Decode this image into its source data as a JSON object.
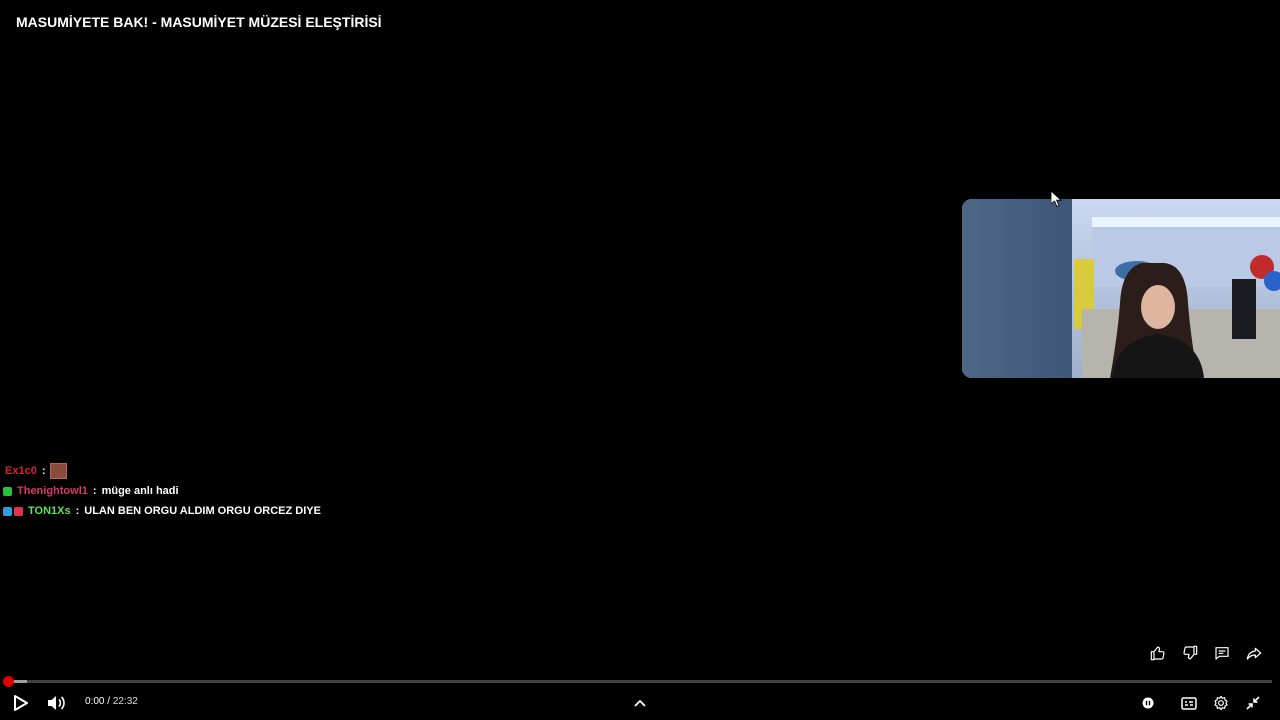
{
  "video": {
    "title": "MASUMİYETE BAK! - MASUMİYET MÜZESİ ELEŞTİRİSİ"
  },
  "chat": [
    {
      "user": "Ex1c0",
      "user_color": "#d0262f",
      "message": "",
      "has_emote": true,
      "badges": []
    },
    {
      "user": "Thenightowl1",
      "user_color": "#d23a6a",
      "message": "müge anlı hadi",
      "has_emote": false,
      "badges": [
        "#2bbf3b"
      ]
    },
    {
      "user": "TON1Xs",
      "user_color": "#63e05a",
      "message": "ULAN BEN ORGU ALDIM ORGU ORCEZ DIYE",
      "has_emote": false,
      "badges": [
        "#2aa0e0",
        "#e0334a"
      ]
    }
  ],
  "chat_separator": ":",
  "player": {
    "current_time": "0:00",
    "separator": " / ",
    "duration": "22:32",
    "progress_fraction": 0.0,
    "buffered_fraction": 0.015,
    "accent": "#e00000"
  },
  "icons": {
    "play": "play-icon",
    "volume": "volume-icon",
    "expand": "chevron-up-icon",
    "autoplay": "autoplay-toggle-icon",
    "captions": "captions-icon",
    "settings": "gear-icon",
    "exit_fullscreen": "exit-fullscreen-icon",
    "like": "thumbs-up-icon",
    "dislike": "thumbs-down-icon",
    "comments": "comment-icon",
    "share": "share-icon"
  }
}
